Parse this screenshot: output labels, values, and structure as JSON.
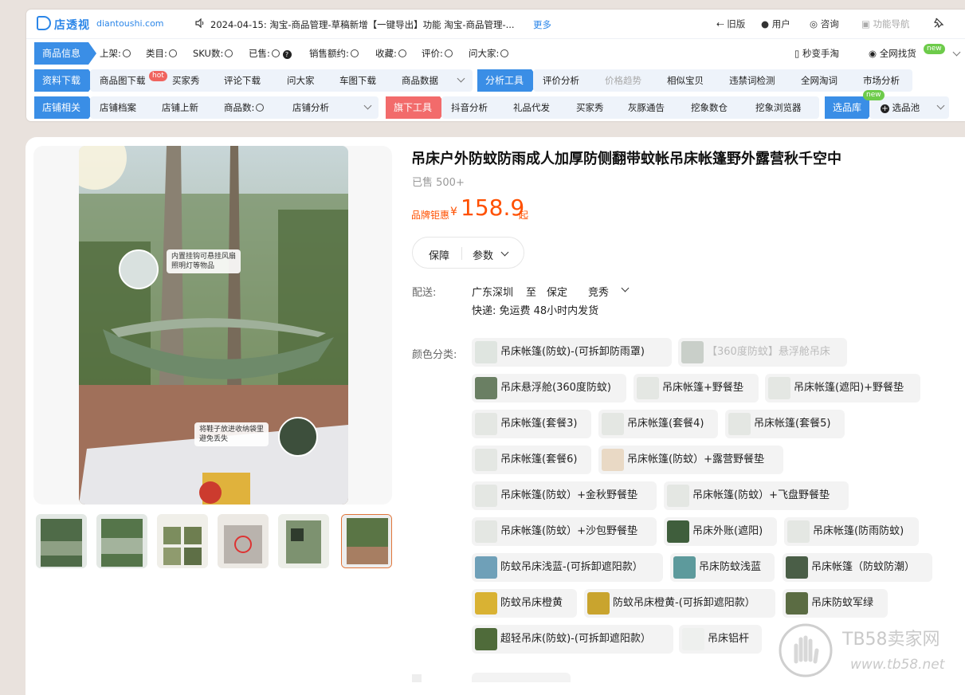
{
  "extension": {
    "logo_text": "店透视",
    "domain": "diantoushi.com",
    "notice": "2024-04-15: 淘宝-商品管理-草稿新增【一键导出】功能 淘宝-商品管理-...",
    "more": "更多",
    "top_nav": [
      "旧版",
      "用户",
      "咨询",
      "功能导航"
    ],
    "row1": {
      "category": "商品信息",
      "items": [
        "上架:",
        "类目:",
        "SKU数:",
        "已售:",
        "销售额约:",
        "收藏:",
        "评价:",
        "问大家:"
      ],
      "right": [
        "秒变手淘",
        "全网找货"
      ],
      "badge": "new"
    },
    "row2": {
      "category": "资料下载",
      "items": [
        "商品图下载",
        "买家秀",
        "评论下载",
        "问大家",
        "车图下载",
        "商品数据"
      ],
      "hot": "hot",
      "category2": "分析工具",
      "items2": [
        "评价分析",
        "价格趋势",
        "相似宝贝",
        "违禁词检测",
        "全网淘词",
        "市场分析"
      ]
    },
    "row3": {
      "category": "店铺相关",
      "items": [
        "店铺档案",
        "店铺上新",
        "商品数:",
        "店铺分析"
      ],
      "category2": "旗下工具",
      "items2": [
        "抖音分析",
        "礼品代发",
        "买家秀",
        "灰豚通告",
        "挖象数仓",
        "挖象浏览器"
      ],
      "category3": "选品库",
      "pool": "选品池",
      "badge": "new"
    }
  },
  "product": {
    "title": "吊床户外防蚊防雨成人加厚防侧翻带蚊帐吊床帐篷野外露营秋千空中",
    "sold": "已售 500+",
    "price_label": "品牌钜惠",
    "currency": "¥",
    "price": "158.9",
    "price_suffix": "起",
    "tab_guarantee": "保障",
    "tab_params": "参数",
    "image_callout_1": "内置挂钩可悬挂风扇\n照明灯等物品",
    "image_callout_2": "将鞋子放进收纳袋里\n避免丢失",
    "shipping_label": "配送:",
    "ship_from": "广东深圳",
    "ship_to_word": "至",
    "ship_to": "保定",
    "ship_district": "竞秀",
    "express": "快递: 免运费  48小时内发货",
    "color_label": "颜色分类:",
    "skus": [
      {
        "label": "吊床帐篷(防蚊)-(可拆卸防雨罩)",
        "disabled": false
      },
      {
        "label": "【360度防蚊】悬浮舱吊床",
        "disabled": true
      },
      {
        "label": "吊床悬浮舱(360度防蚊)",
        "disabled": false
      },
      {
        "label": "吊床帐篷+野餐垫",
        "disabled": false
      },
      {
        "label": "吊床帐篷(遮阳)+野餐垫",
        "disabled": false
      },
      {
        "label": "吊床帐篷(套餐3)",
        "disabled": false
      },
      {
        "label": "吊床帐篷(套餐4)",
        "disabled": false
      },
      {
        "label": "吊床帐篷(套餐5)",
        "disabled": false
      },
      {
        "label": "吊床帐篷(套餐6)",
        "disabled": false
      },
      {
        "label": "吊床帐篷(防蚊）+露营野餐垫",
        "disabled": false
      },
      {
        "label": "吊床帐篷(防蚊）+金秋野餐垫",
        "disabled": false
      },
      {
        "label": "吊床帐篷(防蚊）+飞盘野餐垫",
        "disabled": false
      },
      {
        "label": "吊床帐篷(防蚊）+沙包野餐垫",
        "disabled": false
      },
      {
        "label": "吊床外账(遮阳)",
        "disabled": false
      },
      {
        "label": "吊床帐篷(防雨防蚊)",
        "disabled": false
      },
      {
        "label": "防蚊吊床浅蓝-(可拆卸遮阳款）",
        "disabled": false
      },
      {
        "label": "吊床防蚊浅蓝",
        "disabled": false
      },
      {
        "label": "吊床帐篷（防蚊防潮）",
        "disabled": false
      },
      {
        "label": "防蚊吊床橙黄",
        "disabled": false
      },
      {
        "label": "防蚊吊床橙黄-(可拆卸遮阳款）",
        "disabled": false
      },
      {
        "label": "吊床防蚊军绿",
        "disabled": false
      },
      {
        "label": "超轻吊床(防蚊)-(可拆卸遮阳款）",
        "disabled": false
      },
      {
        "label": "吊床铝杆",
        "disabled": false
      }
    ]
  },
  "watermark": {
    "brand": "TB58卖家网",
    "url": "www.tb58.net"
  },
  "colors": {
    "accent": "#3a8ee6",
    "price": "#ff5000",
    "hot": "#f0645f",
    "new": "#6dcb4a",
    "tool_red": "#f26b6b"
  }
}
